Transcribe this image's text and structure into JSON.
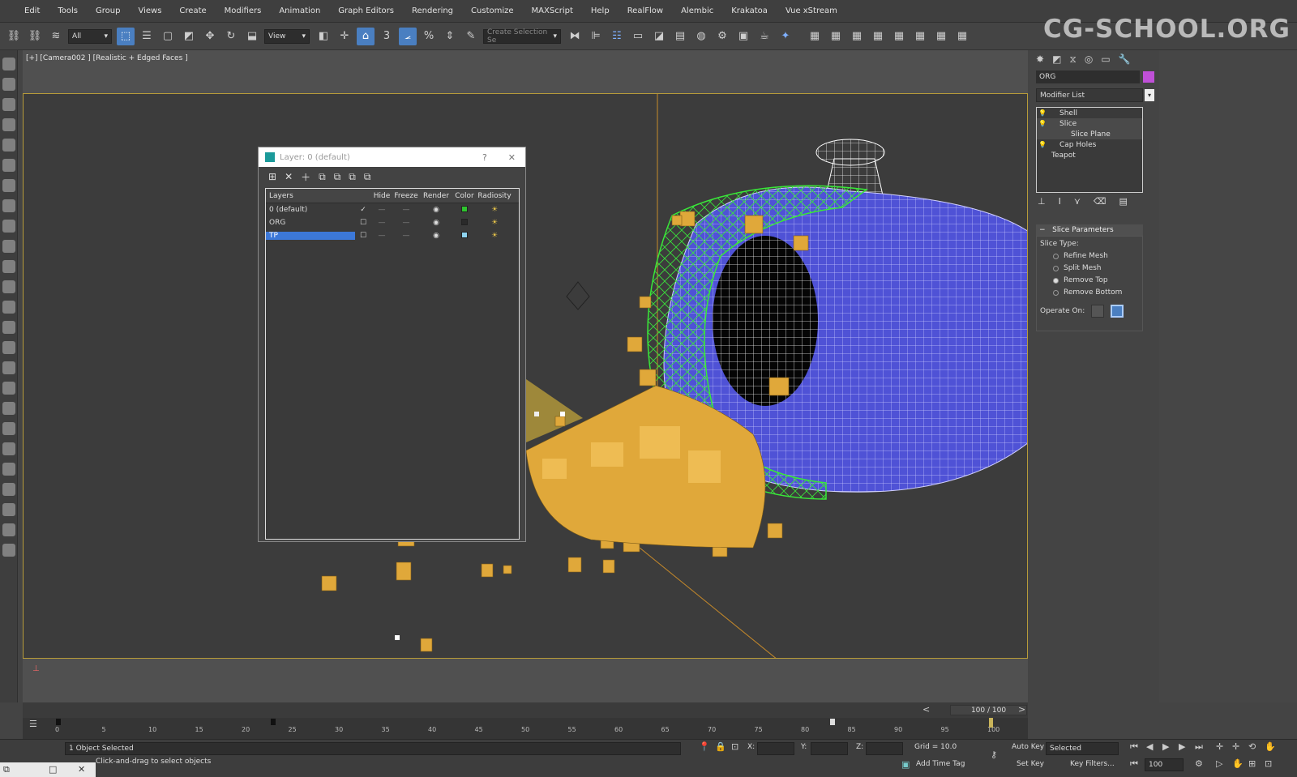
{
  "menu": [
    "Edit",
    "Tools",
    "Group",
    "Views",
    "Create",
    "Modifiers",
    "Animation",
    "Graph Editors",
    "Rendering",
    "Customize",
    "MAXScript",
    "Help",
    "RealFlow",
    "Alembic",
    "Krakatoa",
    "Vue xStream"
  ],
  "toolbar": {
    "selection_filter": "All",
    "ref_coord": "View",
    "named_selection_placeholder": "Create Selection Se",
    "snap_3": "3",
    "snap_angle": "⦟",
    "snap_percent": "%",
    "icons": [
      "link-icon",
      "unlink-icon",
      "bind-icon",
      "select-icon",
      "select-by-name-icon",
      "rect-region-icon",
      "window-crossing-icon",
      "move-icon",
      "rotate-icon",
      "scale-icon",
      "mirror-icon",
      "align-icon",
      "layer-manager-icon",
      "render-setup-icon",
      "render-icon"
    ]
  },
  "watermark": "CG-SCHOOL.ORG",
  "viewport": {
    "label": "[+] [Camera002 ] [Realistic + Edged Faces ]"
  },
  "layer_dialog": {
    "title": "Layer: 0 (default)",
    "help": "?",
    "close": "✕",
    "columns": {
      "layers": "Layers",
      "hide": "Hide",
      "freeze": "Freeze",
      "render": "Render",
      "color": "Color",
      "radiosity": "Radiosity"
    },
    "rows": [
      {
        "name": "0 (default)",
        "check": "✓",
        "hide": "—",
        "freeze": "—",
        "render": "◉",
        "color": "#2ec42e",
        "radiosity": "☀"
      },
      {
        "name": "ORG",
        "check": "☐",
        "hide": "—",
        "freeze": "—",
        "render": "◉",
        "color": "#2a2a2a",
        "radiosity": "☀"
      },
      {
        "name": "TP",
        "check": "☐",
        "hide": "—",
        "freeze": "—",
        "render": "◉",
        "color": "#8fd4f0",
        "radiosity": "☀"
      }
    ]
  },
  "command_panel": {
    "object_name": "ORG",
    "object_color": "#c050d8",
    "modifier_list": "Modifier List",
    "stack": [
      {
        "name": "Shell",
        "level": 1
      },
      {
        "name": "Slice",
        "level": 1
      },
      {
        "name": "Slice Plane",
        "level": 2
      },
      {
        "name": "Cap Holes",
        "level": 1
      },
      {
        "name": "Teapot",
        "level": 0
      }
    ],
    "rollout_title": "Slice Parameters",
    "slice_type_label": "Slice Type:",
    "slice_types": [
      "Refine Mesh",
      "Split Mesh",
      "Remove Top",
      "Remove Bottom"
    ],
    "slice_type_selected": "Remove Top",
    "operate_on_label": "Operate On:"
  },
  "timeline": {
    "frame_readout": "100 / 100",
    "ticks": [
      "0",
      "5",
      "10",
      "15",
      "20",
      "25",
      "30",
      "35",
      "40",
      "45",
      "50",
      "55",
      "60",
      "65",
      "70",
      "75",
      "80",
      "85",
      "90",
      "95",
      "100"
    ],
    "key_frames": [
      0,
      23,
      83
    ],
    "current_frame": 100,
    "frame_max": 100
  },
  "status": {
    "selection": "1 Object Selected",
    "prompt": "Click-and-drag to select objects",
    "x_label": "X:",
    "y_label": "Y:",
    "z_label": "Z:",
    "grid": "Grid = 10.0",
    "add_time_tag": "Add Time Tag",
    "auto_key": "Auto Key",
    "set_key": "Set Key",
    "key_mode": "Selected",
    "key_filters": "Key Filters...",
    "frame_field": "100"
  }
}
